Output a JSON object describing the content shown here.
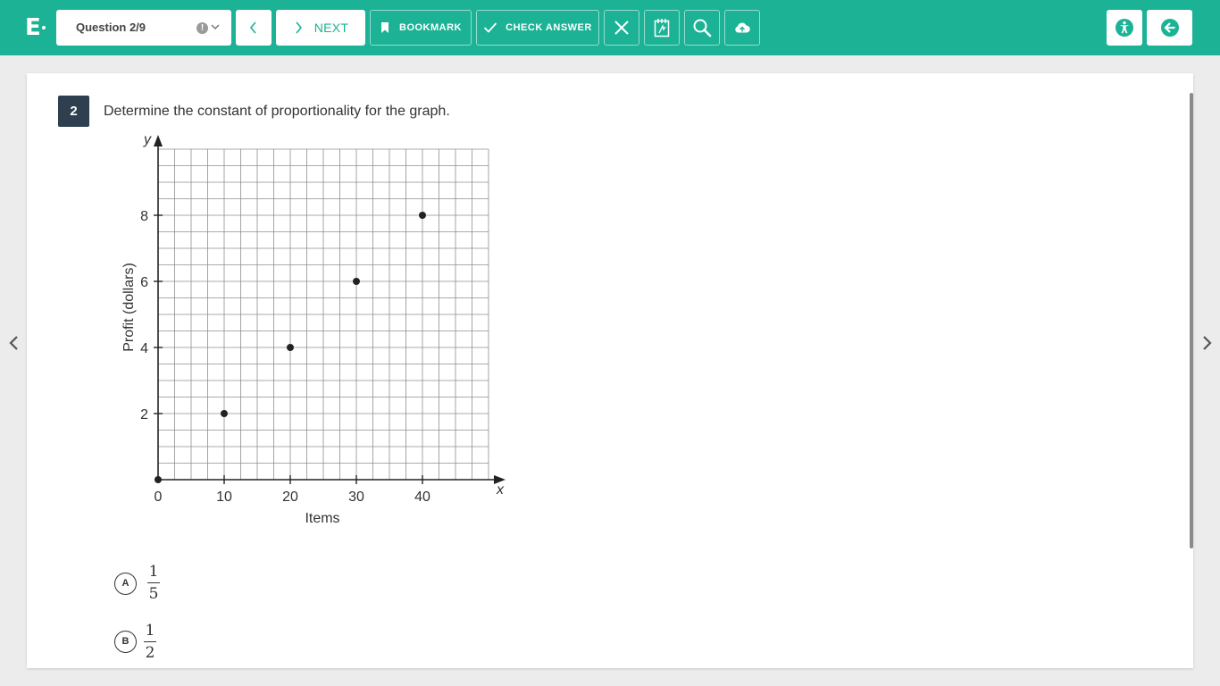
{
  "app": {
    "logo": "E"
  },
  "header": {
    "question_selector": "Question 2/9",
    "next_label": "NEXT",
    "bookmark_label": "BOOKMARK",
    "check_answer_label": "CHECK ANSWER"
  },
  "icons": {
    "prev": "chevron-left-icon",
    "next": "chevron-right-icon",
    "bookmark": "bookmark-icon",
    "check": "check-icon",
    "eliminate": "close-icon",
    "notepad": "notepad-icon",
    "zoom": "magnifier-icon",
    "save": "cloud-upload-icon",
    "accessibility": "accessibility-icon",
    "exit": "exit-arrow-icon"
  },
  "colors": {
    "brand": "#1bb295",
    "question_badge": "#2e3f4f"
  },
  "question": {
    "number": "2",
    "text": "Determine the constant of proportionality for the graph."
  },
  "chart_data": {
    "type": "scatter",
    "xlabel": "Items",
    "ylabel": "Profit (dollars)",
    "x_axis_name": "x",
    "y_axis_name": "y",
    "x_ticks": [
      "0",
      "10",
      "20",
      "30",
      "40"
    ],
    "y_ticks": [
      "2",
      "4",
      "6",
      "8"
    ],
    "xlim": [
      0,
      50
    ],
    "ylim": [
      0,
      10
    ],
    "grid": true,
    "points": [
      {
        "x": 0,
        "y": 0
      },
      {
        "x": 10,
        "y": 2
      },
      {
        "x": 20,
        "y": 4
      },
      {
        "x": 30,
        "y": 6
      },
      {
        "x": 40,
        "y": 8
      }
    ]
  },
  "options": [
    {
      "letter": "A",
      "numerator": "1",
      "denominator": "5"
    },
    {
      "letter": "B",
      "numerator": "1",
      "denominator": "2"
    }
  ]
}
